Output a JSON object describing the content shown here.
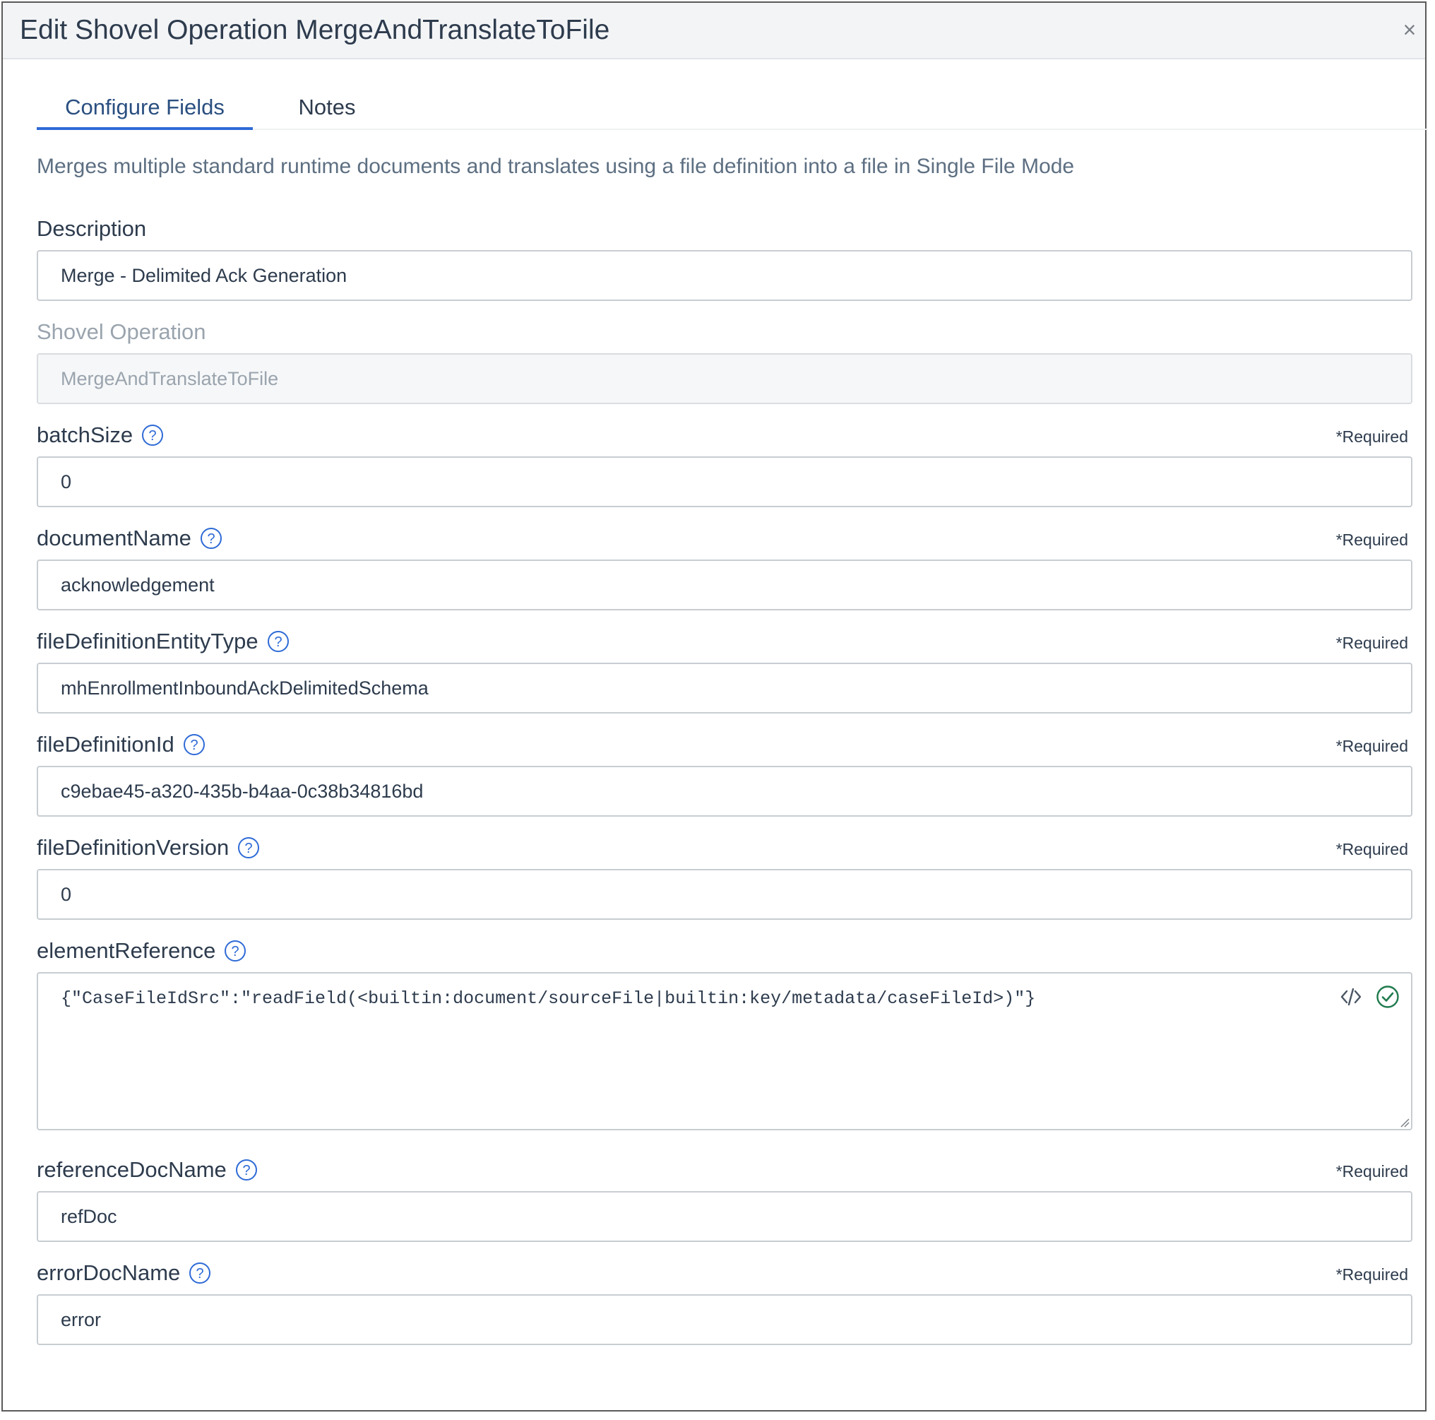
{
  "dialog": {
    "title": "Edit Shovel Operation MergeAndTranslateToFile",
    "close_label": "×"
  },
  "tabs": [
    {
      "label": "Configure Fields",
      "active": true
    },
    {
      "label": "Notes",
      "active": false
    }
  ],
  "help_text": "Merges multiple standard runtime documents and translates using a file definition into a file in Single File Mode",
  "required_label": "*Required",
  "fields": {
    "description": {
      "label": "Description",
      "value": "Merge - Delimited Ack Generation"
    },
    "shovel_operation": {
      "label": "Shovel Operation",
      "value": "MergeAndTranslateToFile"
    },
    "batch_size": {
      "label": "batchSize",
      "value": "0"
    },
    "document_name": {
      "label": "documentName",
      "value": "acknowledgement"
    },
    "file_definition_entity_type": {
      "label": "fileDefinitionEntityType",
      "value": "mhEnrollmentInboundAckDelimitedSchema"
    },
    "file_definition_id": {
      "label": "fileDefinitionId",
      "value": "c9ebae45-a320-435b-b4aa-0c38b34816bd"
    },
    "file_definition_version": {
      "label": "fileDefinitionVersion",
      "value": "0"
    },
    "element_reference": {
      "label": "elementReference",
      "value": "{\"CaseFileIdSrc\":\"readField(<builtin:document/sourceFile|builtin:key/metadata/caseFileId>)\"}"
    },
    "reference_doc_name": {
      "label": "referenceDocName",
      "value": "refDoc"
    },
    "error_doc_name": {
      "label": "errorDocName",
      "value": "error"
    }
  },
  "colors": {
    "accent": "#2f6bd6",
    "valid": "#1f7a4d",
    "header_bg": "#f3f4f6"
  },
  "icons": {
    "help": "question-circle-icon",
    "code": "code-icon",
    "valid": "check-circle-icon",
    "close": "close-icon"
  }
}
